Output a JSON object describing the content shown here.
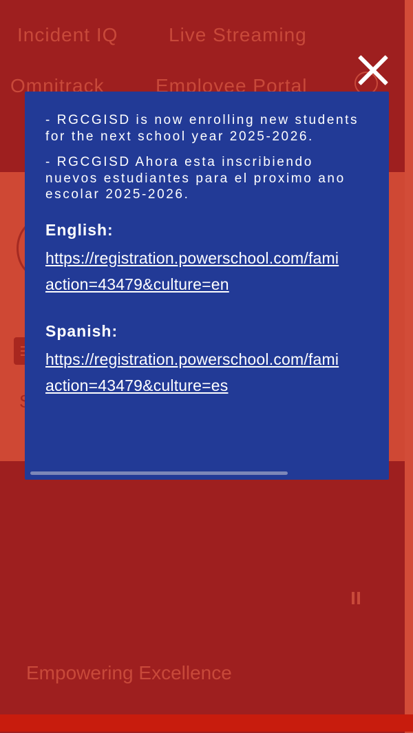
{
  "background": {
    "nav": {
      "incident_iq": "Incident IQ",
      "live_streaming": "Live Streaming",
      "omnitrack": "Omnitrack",
      "employee_portal": "Employee Portal"
    },
    "fragment_s": "S",
    "tagline": "Empowering Excellence"
  },
  "modal": {
    "notice_en": "- RGCGISD is now enrolling new students for the next school year 2025-2026.",
    "notice_es": "- RGCGISD Ahora esta inscribiendo nuevos estudiantes para el proximo ano escolar 2025-2026.",
    "english_label": "English:",
    "english_link_line1": "https://registration.powerschool.com/fami",
    "english_link_line2": "action=43479&culture=en",
    "spanish_label": "Spanish:",
    "spanish_link_line1": "https://registration.powerschool.com/fami",
    "spanish_link_line2": "action=43479&culture=es"
  },
  "colors": {
    "page_red": "#9e1f1f",
    "band_red": "#cf4834",
    "modal_blue": "#223a96",
    "accent_red": "#c81c0d"
  },
  "icons": {
    "close": "close-icon",
    "pause": "pause-icon",
    "search": "search-icon",
    "menu": "hamburger-menu-icon"
  }
}
